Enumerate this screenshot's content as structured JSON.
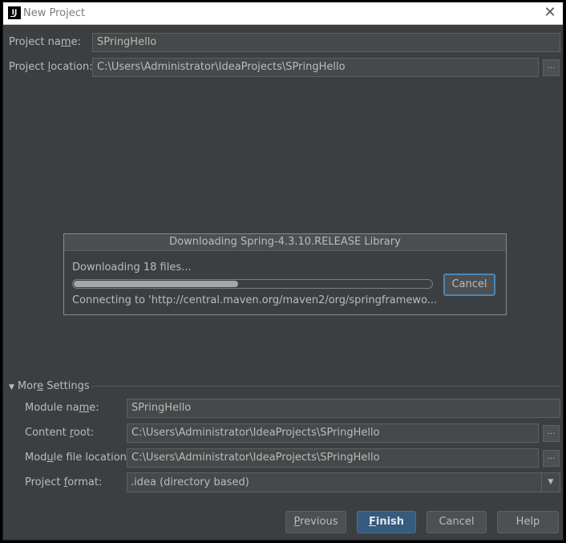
{
  "window": {
    "title": "New Project",
    "app_icon_text": "IJ"
  },
  "project": {
    "name_label_pre": "Project na",
    "name_label_key": "m",
    "name_label_post": "e:",
    "name_value": "SPringHello",
    "location_label_pre": "Project ",
    "location_label_key": "l",
    "location_label_post": "ocation:",
    "location_value": "C:\\Users\\Administrator\\IdeaProjects\\SPringHello",
    "browse_label": "..."
  },
  "download_dialog": {
    "title": "Downloading Spring-4.3.10.RELEASE Library",
    "status": "Downloading 18 files...",
    "progress_fraction": 0.46,
    "connecting": "Connecting to 'http://central.maven.org/maven2/org/springframewo...",
    "cancel_label": "Cancel"
  },
  "more_settings": {
    "label_pre": "Mor",
    "label_key": "e",
    "label_post": " Settings",
    "module_name_label_pre": "Module na",
    "module_name_label_key": "m",
    "module_name_label_post": "e:",
    "module_name_value": "SPringHello",
    "content_root_label_pre": "Content ",
    "content_root_label_key": "r",
    "content_root_label_post": "oot:",
    "content_root_value": "C:\\Users\\Administrator\\IdeaProjects\\SPringHello",
    "module_file_label_pre": "Mod",
    "module_file_label_key": "u",
    "module_file_label_post": "le file location:",
    "module_file_value": "C:\\Users\\Administrator\\IdeaProjects\\SPringHello",
    "project_format_label_pre": "Project ",
    "project_format_label_key": "f",
    "project_format_label_post": "ormat:",
    "project_format_value": ".idea (directory based)"
  },
  "buttons": {
    "previous_key": "P",
    "previous_rest": "revious",
    "finish_key": "F",
    "finish_rest": "inish",
    "cancel": "Cancel",
    "help": "Help"
  },
  "colors": {
    "background": "#3c3f41",
    "field": "#45494a",
    "default_button": "#375a7f",
    "focus_border": "#4b87b8"
  }
}
